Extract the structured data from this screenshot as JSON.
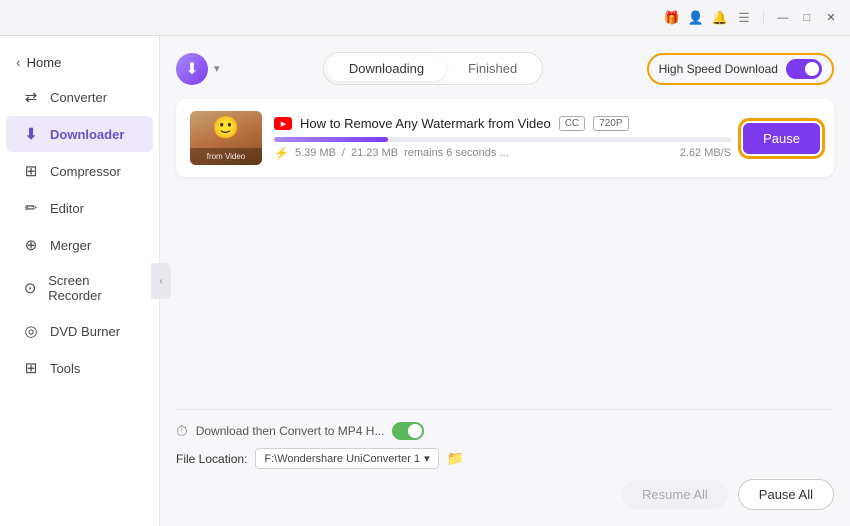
{
  "titlebar": {
    "icons": [
      "🎁",
      "👤",
      "🔔",
      "☰"
    ],
    "buttons": [
      "—",
      "□",
      "✕"
    ]
  },
  "sidebar": {
    "back_label": "Home",
    "items": [
      {
        "id": "converter",
        "label": "Converter",
        "icon": "⇄"
      },
      {
        "id": "downloader",
        "label": "Downloader",
        "icon": "⬇",
        "active": true
      },
      {
        "id": "compressor",
        "label": "Compressor",
        "icon": "⊞"
      },
      {
        "id": "editor",
        "label": "Editor",
        "icon": "✏"
      },
      {
        "id": "merger",
        "label": "Merger",
        "icon": "⊕"
      },
      {
        "id": "screen_recorder",
        "label": "Screen Recorder",
        "icon": "⊙"
      },
      {
        "id": "dvd_burner",
        "label": "DVD Burner",
        "icon": "◎"
      },
      {
        "id": "tools",
        "label": "Tools",
        "icon": "⊞"
      }
    ]
  },
  "tabs": {
    "downloading": "Downloading",
    "finished": "Finished",
    "active": "downloading"
  },
  "high_speed": {
    "label": "High Speed Download",
    "enabled": true
  },
  "download_item": {
    "title": "How to Remove Any Watermark from Video",
    "badge_cc": "CC",
    "badge_720p": "720P",
    "progress_pct": 25,
    "size_downloaded": "5.39 MB",
    "size_total": "21.23 MB",
    "time_remaining": "remains 6 seconds ...",
    "speed": "2.62 MB/S",
    "pause_label": "Pause"
  },
  "bottom": {
    "convert_label": "Download then Convert to MP4 H...",
    "file_location_label": "File Location:",
    "file_path": "F:\\Wondershare UniConverter 1",
    "resume_all_label": "Resume All",
    "pause_all_label": "Pause All"
  }
}
